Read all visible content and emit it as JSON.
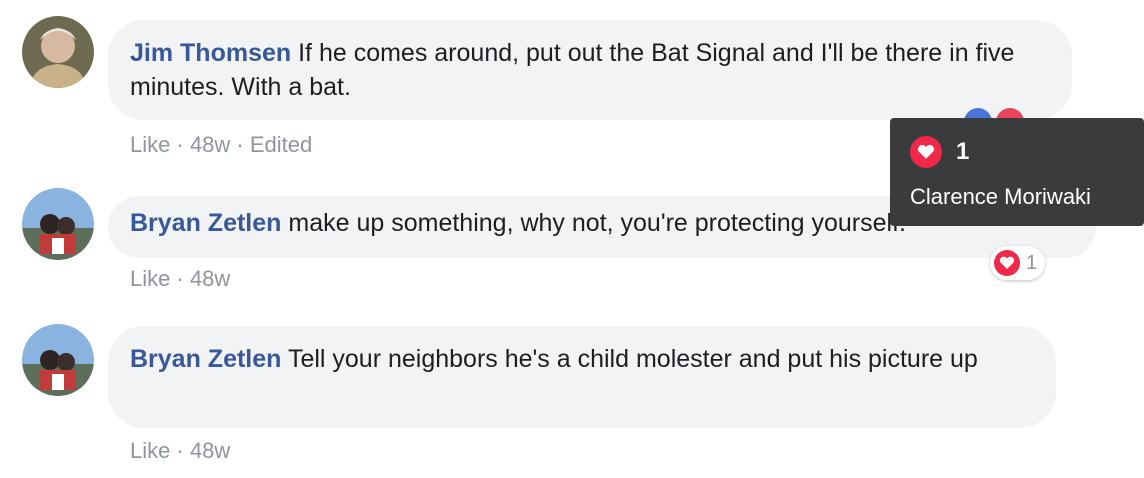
{
  "comments": [
    {
      "author": "Jim Thomsen",
      "text": "If he comes around, put out the Bat Signal and I'll be there in five minutes. With a bat.",
      "like_label": "Like",
      "age": "48w",
      "edited": "Edited"
    },
    {
      "author": "Bryan Zetlen",
      "text": "make up something, why not, you're protecting yourself.",
      "like_label": "Like",
      "age": "48w",
      "reaction_count": "1"
    },
    {
      "author": "Bryan Zetlen",
      "text": "Tell your neighbors he's a child molester and put his picture up",
      "like_label": "Like",
      "age": "48w"
    }
  ],
  "tooltip": {
    "count": "1",
    "names": "Clarence Moriwaki"
  },
  "colors": {
    "author": "#385898",
    "bubble": "#f2f3f5",
    "love": "#f0284a",
    "meta": "#90949c",
    "tooltip_bg": "#3a3b3c"
  },
  "icons": {
    "reaction": "heart-icon",
    "peek": "like-reaction-icon"
  },
  "separator": "·"
}
